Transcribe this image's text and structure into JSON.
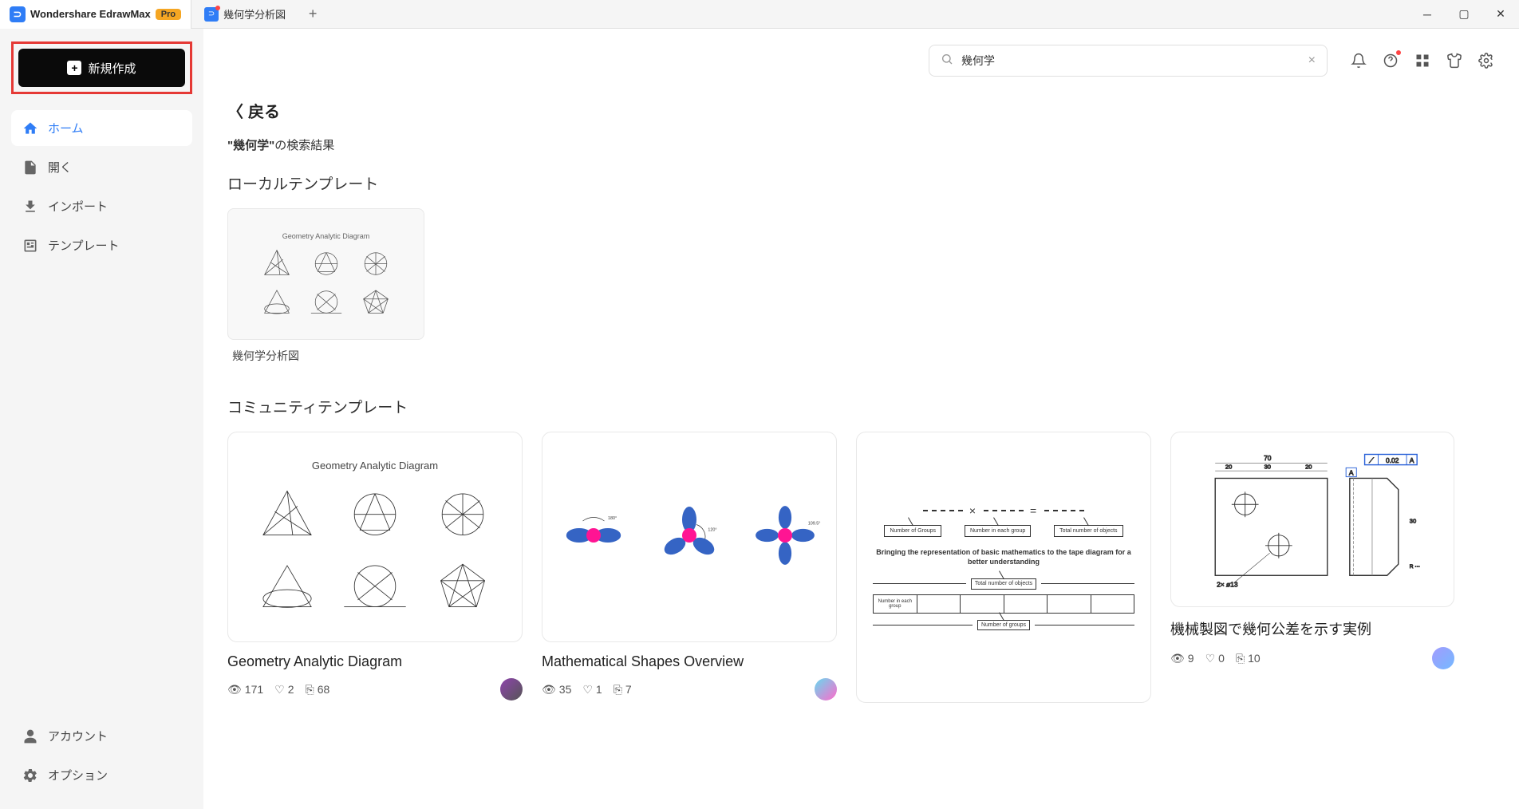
{
  "titlebar": {
    "app_name": "Wondershare EdrawMax",
    "app_logo_letter": "⊃",
    "pro_label": "Pro",
    "doc_tab": "幾何学分析図",
    "doc_logo_letter": "⊃"
  },
  "sidebar": {
    "new_label": "新規作成",
    "items": [
      {
        "label": "ホーム",
        "icon": "home"
      },
      {
        "label": "開く",
        "icon": "file"
      },
      {
        "label": "インポート",
        "icon": "import"
      },
      {
        "label": "テンプレート",
        "icon": "template"
      }
    ],
    "bottom": [
      {
        "label": "アカウント",
        "icon": "account"
      },
      {
        "label": "オプション",
        "icon": "options"
      }
    ]
  },
  "search": {
    "value": "幾何学",
    "placeholder": ""
  },
  "content": {
    "back_label": "戻る",
    "result_prefix": "\"幾何学\"",
    "result_suffix": "の検索結果",
    "section_local": "ローカルテンプレート",
    "section_community": "コミュニティテンプレート",
    "local_templates": [
      {
        "label": "幾何学分析図",
        "thumb_title": "Geometry Analytic Diagram"
      }
    ],
    "community_templates": [
      {
        "title": "Geometry Analytic Diagram",
        "thumb_title": "Geometry Analytic Diagram",
        "views": "171",
        "likes": "2",
        "copies": "68",
        "avatar": "grad1"
      },
      {
        "title": "Mathematical Shapes Overview",
        "views": "35",
        "likes": "1",
        "copies": "7",
        "avatar": "grad2"
      },
      {
        "title": "",
        "tape_caption": "Bringing the representation of basic mathematics to the tape diagram for a better understanding",
        "box1": "Number of Groups",
        "box2": "Number in each group",
        "box3": "Total number of objects",
        "cell_a": "Number in each group",
        "cell_b": "Number of groups",
        "cell_c": "Total number of objects"
      },
      {
        "title": "機械製図で幾何公差を示す実例",
        "views": "9",
        "likes": "0",
        "copies": "10",
        "mech_val": "0.02",
        "mech_letter": "A",
        "mech_top": "70",
        "mech_n1": "20",
        "mech_n2": "30",
        "mech_n3": "20",
        "mech_bl": "2× ø13",
        "avatar": "grad3"
      }
    ]
  }
}
